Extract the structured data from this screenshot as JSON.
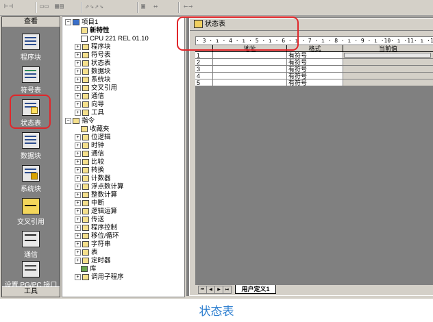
{
  "toolbar": {
    "groups": [
      "⊢⊣",
      "←→",
      "▭▭",
      "▦▤",
      "⇗⇘⇗⇘",
      "▣",
      "↔"
    ]
  },
  "nav": {
    "header": "查看",
    "footer": "工具",
    "items": [
      {
        "label": "程序块",
        "icon": "program-block-icon"
      },
      {
        "label": "符号表",
        "icon": "symbol-table-icon"
      },
      {
        "label": "状态表",
        "icon": "status-table-icon",
        "selected": true
      },
      {
        "label": "数据块",
        "icon": "data-block-icon"
      },
      {
        "label": "系统块",
        "icon": "system-block-icon"
      },
      {
        "label": "交叉引用",
        "icon": "cross-reference-icon"
      },
      {
        "label": "通信",
        "icon": "communication-icon"
      },
      {
        "label": "设置 PG/PC 接口",
        "icon": "pg-pc-interface-icon"
      }
    ]
  },
  "tree": {
    "project": [
      {
        "label": "项目1",
        "depth": 0,
        "exp": "-",
        "bold": false
      },
      {
        "label": "新特性",
        "depth": 1,
        "exp": "",
        "bold": true
      },
      {
        "label": "CPU 221 REL 01.10",
        "depth": 1,
        "exp": "",
        "bold": false
      },
      {
        "label": "程序块",
        "depth": 1,
        "exp": "+",
        "bold": false
      },
      {
        "label": "符号表",
        "depth": 1,
        "exp": "+",
        "bold": false
      },
      {
        "label": "状态表",
        "depth": 1,
        "exp": "+",
        "bold": false
      },
      {
        "label": "数据块",
        "depth": 1,
        "exp": "+",
        "bold": false
      },
      {
        "label": "系统块",
        "depth": 1,
        "exp": "+",
        "bold": false
      },
      {
        "label": "交叉引用",
        "depth": 1,
        "exp": "+",
        "bold": false
      },
      {
        "label": "通信",
        "depth": 1,
        "exp": "+",
        "bold": false
      },
      {
        "label": "向导",
        "depth": 1,
        "exp": "+",
        "bold": false
      },
      {
        "label": "工具",
        "depth": 1,
        "exp": "+",
        "bold": false
      }
    ],
    "instructions_root": "指令",
    "instructions": [
      {
        "label": "收藏夹",
        "exp": ""
      },
      {
        "label": "位逻辑",
        "exp": "+"
      },
      {
        "label": "时钟",
        "exp": "+"
      },
      {
        "label": "通信",
        "exp": "+"
      },
      {
        "label": "比较",
        "exp": "+"
      },
      {
        "label": "转换",
        "exp": "+"
      },
      {
        "label": "计数器",
        "exp": "+"
      },
      {
        "label": "浮点数计算",
        "exp": "+"
      },
      {
        "label": "整数计算",
        "exp": "+"
      },
      {
        "label": "中断",
        "exp": "+"
      },
      {
        "label": "逻辑运算",
        "exp": "+"
      },
      {
        "label": "传送",
        "exp": "+"
      },
      {
        "label": "程序控制",
        "exp": "+"
      },
      {
        "label": "移位/循环",
        "exp": "+"
      },
      {
        "label": "字符串",
        "exp": "+"
      },
      {
        "label": "表",
        "exp": "+"
      },
      {
        "label": "定时器",
        "exp": "+"
      },
      {
        "label": "库",
        "exp": ""
      },
      {
        "label": "调用子程序",
        "exp": "+"
      }
    ]
  },
  "status_window": {
    "title": "状态表",
    "ruler": "· 3 · ı · 4 · ı · 5 · ı · 6 · ı · 7 · ı · 8 · ı · 9 · ı ·10· ı ·11· ı ·12· ı ·13",
    "columns": [
      "地址",
      "格式",
      "当前值"
    ],
    "rows": [
      {
        "n": "1",
        "address": "",
        "format": "有符号",
        "value": ""
      },
      {
        "n": "2",
        "address": "",
        "format": "有符号",
        "value": ""
      },
      {
        "n": "3",
        "address": "",
        "format": "有符号",
        "value": ""
      },
      {
        "n": "4",
        "address": "",
        "format": "有符号",
        "value": ""
      },
      {
        "n": "5",
        "address": "",
        "format": "有符号",
        "value": ""
      }
    ],
    "tab_nav": [
      "⏮",
      "◀",
      "▶",
      "⏭"
    ],
    "sheet_tab": "用户定义1"
  },
  "caption": "状态表",
  "colors": {
    "highlight": "#e0262a",
    "caption": "#2e7fd0",
    "chrome": "#d4d0c8"
  }
}
